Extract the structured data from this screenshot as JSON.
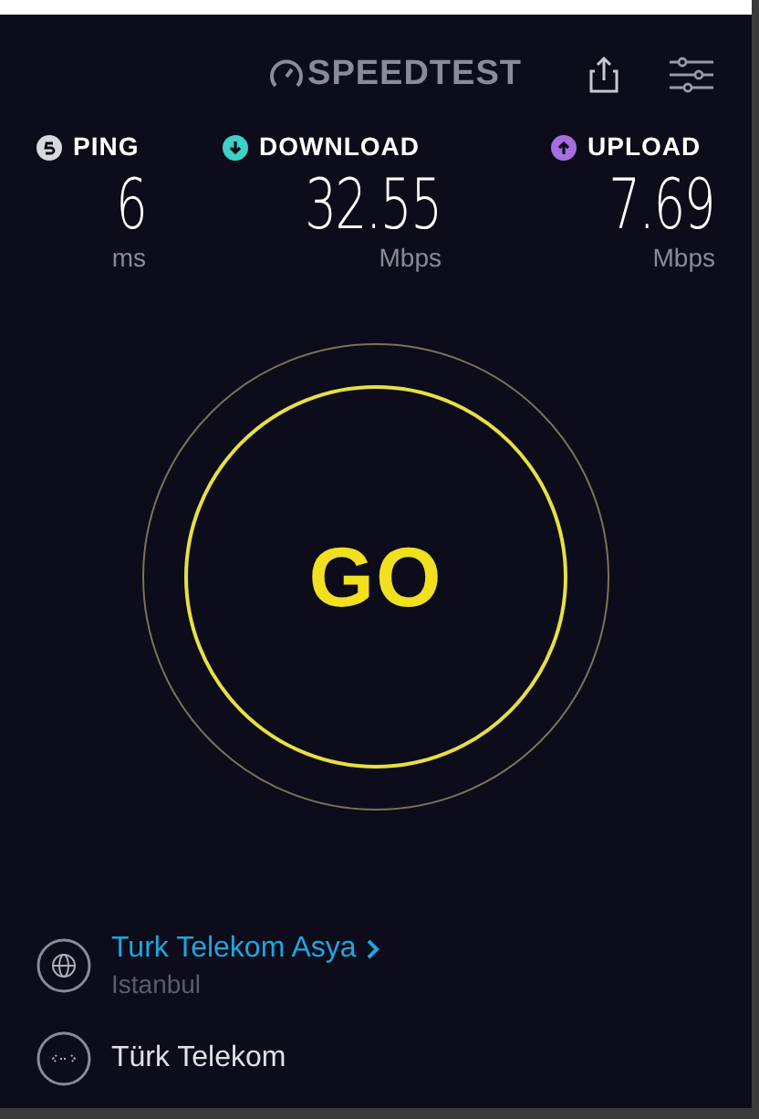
{
  "header": {
    "logo": "SPEEDTEST"
  },
  "metrics": [
    {
      "label": "PING",
      "value": "6",
      "unit": "ms",
      "color": "#d8d8e0",
      "kind": "ping"
    },
    {
      "label": "DOWNLOAD",
      "value": "32.55",
      "unit": "Mbps",
      "color": "#3fd0c8",
      "kind": "download"
    },
    {
      "label": "UPLOAD",
      "value": "7.69",
      "unit": "Mbps",
      "color": "#a66ee0",
      "kind": "upload"
    }
  ],
  "go_button": {
    "label": "GO"
  },
  "server": {
    "name": "Turk Telekom Asya",
    "location": "Istanbul"
  },
  "provider": {
    "name": "Türk Telekom"
  }
}
